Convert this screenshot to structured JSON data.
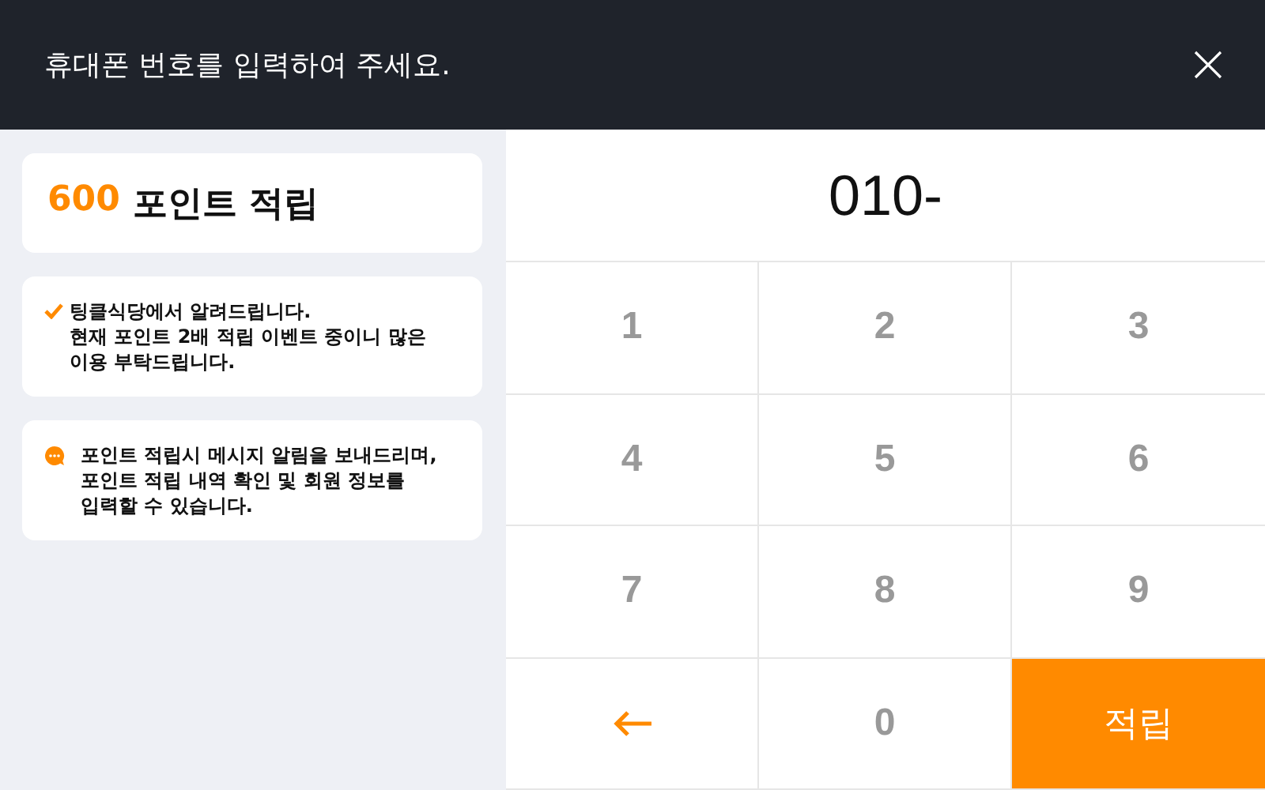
{
  "header": {
    "title": "휴대폰 번호를 입력하여 주세요."
  },
  "points": {
    "amount": "600",
    "label": "포인트 적립"
  },
  "notices": [
    {
      "kind": "check",
      "text": "팅클식당에서 알려드립니다.\n현재 포인트 2배 적립 이벤트 중이니 많은\n이용 부탁드립니다."
    },
    {
      "kind": "chat",
      "text": "포인트 적립시 메시지 알림을 보내드리며,\n포인트 적립 내역 확인 및 회원 정보를\n입력할 수 있습니다."
    }
  ],
  "phone": {
    "value": "010-"
  },
  "keys": [
    {
      "kind": "digit",
      "label": "1"
    },
    {
      "kind": "digit",
      "label": "2"
    },
    {
      "kind": "digit",
      "label": "3"
    },
    {
      "kind": "digit",
      "label": "4"
    },
    {
      "kind": "digit",
      "label": "5"
    },
    {
      "kind": "digit",
      "label": "6"
    },
    {
      "kind": "digit",
      "label": "7"
    },
    {
      "kind": "digit",
      "label": "8"
    },
    {
      "kind": "digit",
      "label": "9"
    },
    {
      "kind": "backspace"
    },
    {
      "kind": "digit",
      "label": "0"
    },
    {
      "kind": "action",
      "label": "적립"
    }
  ]
}
